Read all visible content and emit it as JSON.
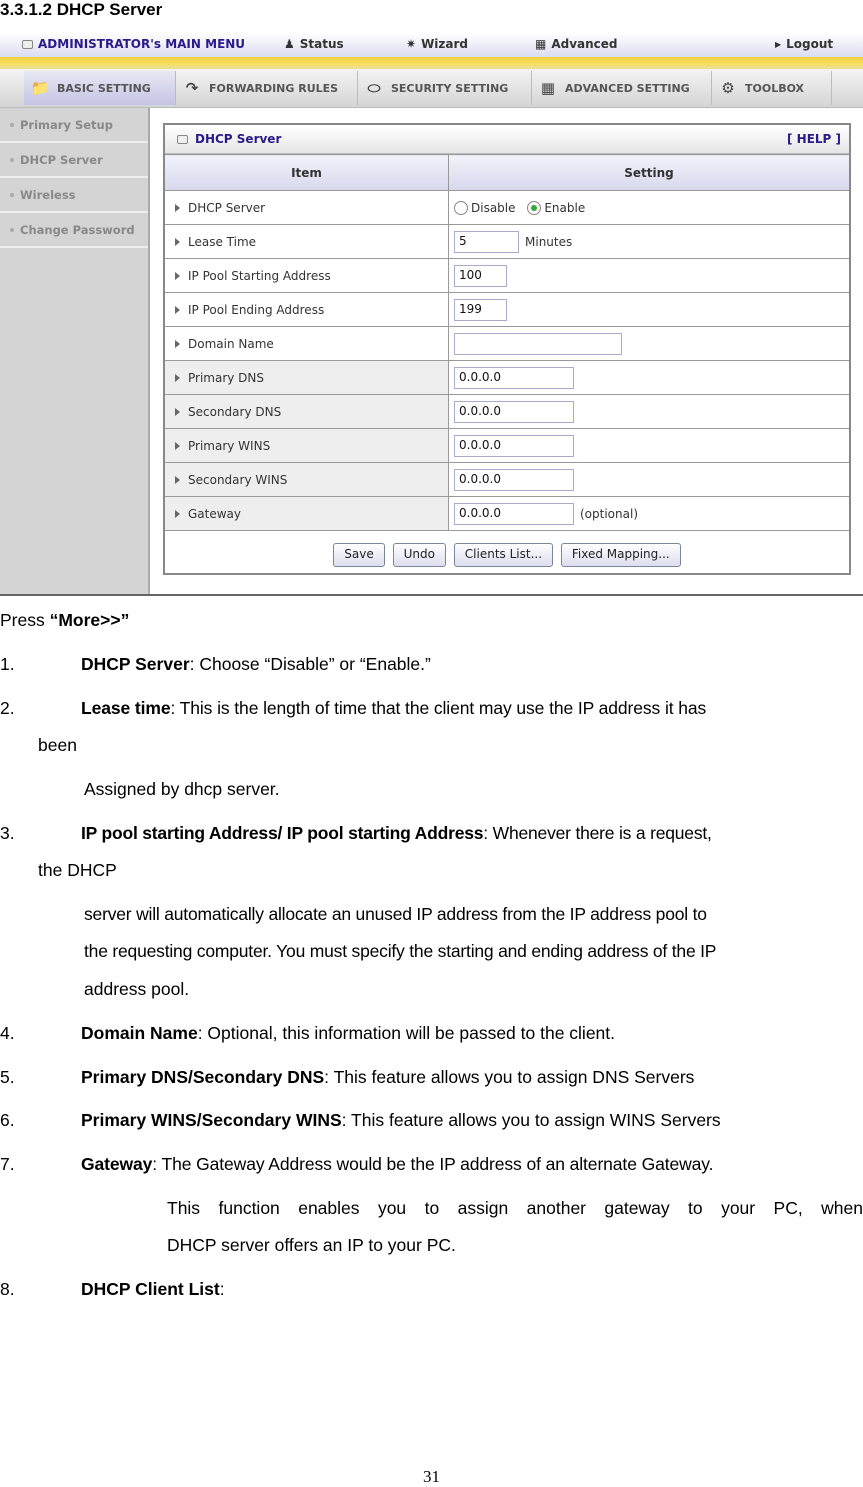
{
  "heading": "3.3.1.2 DHCP Server",
  "topbar": {
    "admin_menu": "ADMINISTRATOR's MAIN MENU",
    "status": "Status",
    "wizard": "Wizard",
    "advanced": "Advanced",
    "logout": "Logout"
  },
  "tabs": [
    {
      "label": "BASIC SETTING",
      "icon": "folder-icon",
      "active": true
    },
    {
      "label": "FORWARDING RULES",
      "icon": "forwarding-icon"
    },
    {
      "label": "SECURITY SETTING",
      "icon": "security-icon"
    },
    {
      "label": "ADVANCED SETTING",
      "icon": "advanced-icon"
    },
    {
      "label": "TOOLBOX",
      "icon": "toolbox-icon"
    }
  ],
  "sidebar": {
    "items": [
      {
        "label": "Primary Setup"
      },
      {
        "label": "DHCP Server"
      },
      {
        "label": "Wireless"
      },
      {
        "label": "Change Password"
      }
    ]
  },
  "panel": {
    "title": "DHCP Server",
    "help": "[ HELP ]",
    "col_item": "Item",
    "col_setting": "Setting",
    "rows": {
      "dhcp_server": {
        "label": "DHCP Server",
        "options": [
          "Disable",
          "Enable"
        ],
        "selected": "Enable"
      },
      "lease_time": {
        "label": "Lease Time",
        "value": "5",
        "suffix": "Minutes"
      },
      "pool_start": {
        "label": "IP Pool Starting Address",
        "value": "100"
      },
      "pool_end": {
        "label": "IP Pool Ending Address",
        "value": "199"
      },
      "domain": {
        "label": "Domain Name",
        "value": ""
      },
      "pdns": {
        "label": "Primary DNS",
        "value": "0.0.0.0"
      },
      "sdns": {
        "label": "Secondary DNS",
        "value": "0.0.0.0"
      },
      "pwins": {
        "label": "Primary WINS",
        "value": "0.0.0.0"
      },
      "swins": {
        "label": "Secondary WINS",
        "value": "0.0.0.0"
      },
      "gateway": {
        "label": "Gateway",
        "value": "0.0.0.0",
        "suffix": "(optional)"
      }
    },
    "buttons": {
      "save": "Save",
      "undo": "Undo",
      "clients": "Clients List...",
      "fixed": "Fixed Mapping..."
    }
  },
  "doc": {
    "press_prefix": "Press ",
    "press_bold": "“More>>”",
    "items": [
      {
        "num": "1.",
        "bold": "DHCP Server",
        "text": ": Choose “Disable” or “Enable.”"
      },
      {
        "num": "2.",
        "bold": "Lease time",
        "text": ": This is the length of time that the client may use the IP address it has",
        "cont": "been",
        "cont2": "Assigned by dhcp server."
      },
      {
        "num": "3.",
        "bold": "IP pool starting Address/ IP pool starting Address",
        "text": ": Whenever there is a request,",
        "cont": "the DHCP",
        "cont2": "server will automatically allocate an unused IP address from the IP address pool to",
        "cont3": "the requesting computer. You must specify the starting and ending address of the IP",
        "cont4": "address pool."
      },
      {
        "num": "4.",
        "bold": "Domain Name",
        "text": ": Optional, this information will be passed to the client."
      },
      {
        "num": "5.",
        "bold": "Primary DNS/Secondary DNS",
        "text": ": This feature allows you to assign DNS Servers"
      },
      {
        "num": "6.",
        "bold": "Primary WINS/Secondary WINS",
        "text": ": This feature allows you to assign WINS Servers"
      },
      {
        "num": "7.",
        "bold": "Gateway",
        "text": ": The Gateway Address would be the IP address of an alternate Gateway.",
        "cont": "This function enables you to assign another gateway to your PC, when",
        "cont2": "DHCP server offers an IP to your PC."
      },
      {
        "num": "8.",
        "bold": "DHCP Client List",
        "text": ":"
      }
    ]
  },
  "page_number": "31"
}
